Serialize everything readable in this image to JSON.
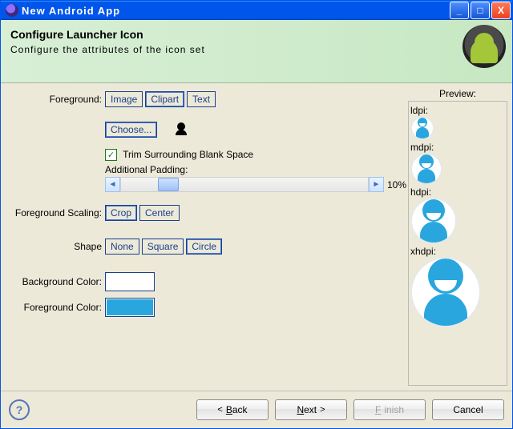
{
  "window": {
    "title": "New Android App"
  },
  "banner": {
    "heading": "Configure Launcher Icon",
    "sub": "Configure the attributes of the icon set"
  },
  "labels": {
    "foreground": "Foreground:",
    "scaling": "Foreground Scaling:",
    "shape": "Shape",
    "bgcolor": "Background Color:",
    "fgcolor": "Foreground Color:",
    "additional_padding": "Additional Padding:",
    "trim": "Trim Surrounding Blank Space"
  },
  "foreground_opts": {
    "image": "Image",
    "clipart": "Clipart",
    "text": "Text"
  },
  "choose": "Choose...",
  "padding_pct": "10%",
  "scaling_opts": {
    "crop": "Crop",
    "center": "Center"
  },
  "shape_opts": {
    "none": "None",
    "square": "Square",
    "circle": "Circle"
  },
  "colors": {
    "bg": "#ffffff",
    "fg": "#2aa6df"
  },
  "preview": {
    "title": "Preview:",
    "ldpi": "ldpi:",
    "mdpi": "mdpi:",
    "hdpi": "hdpi:",
    "xhdpi": "xhdpi:"
  },
  "footer": {
    "back": "Back",
    "next": "Next",
    "finish": "Finish",
    "cancel": "Cancel"
  }
}
